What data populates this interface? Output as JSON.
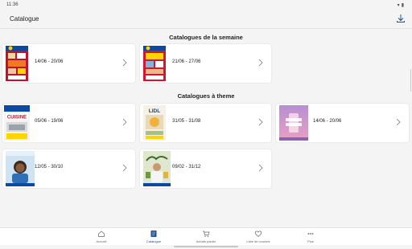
{
  "status_bar": {
    "time": "11:36"
  },
  "app_bar": {
    "title": "Catalogue",
    "download_icon": "download-icon"
  },
  "sections": {
    "weekly": {
      "title": "Catalogues de la semaine",
      "items": [
        {
          "dates": "14/06 - 20/06"
        },
        {
          "dates": "21/06 - 27/06"
        }
      ]
    },
    "theme": {
      "title": "Catalogues à theme",
      "items": [
        {
          "dates": "05/06 - 19/06",
          "cover_text": "CUISINE"
        },
        {
          "dates": "31/05 - 31/08",
          "cover_text": "LIDL"
        },
        {
          "dates": "14/06 - 20/06"
        },
        {
          "dates": "12/05 - 30/10"
        },
        {
          "dates": "09/02 - 31/12"
        }
      ]
    }
  },
  "bottom_nav": {
    "items": [
      {
        "label": "Accueil",
        "icon": "home-icon"
      },
      {
        "label": "Catalogue",
        "icon": "catalogue-icon",
        "active": true
      },
      {
        "label": "Achats panier",
        "icon": "cart-icon"
      },
      {
        "label": "Liste de courses",
        "icon": "heart-list-icon"
      },
      {
        "label": "Plus",
        "icon": "more-icon"
      }
    ]
  },
  "colors": {
    "accent": "#1a4f9c",
    "background": "#f4f4f5",
    "card": "#ffffff"
  }
}
